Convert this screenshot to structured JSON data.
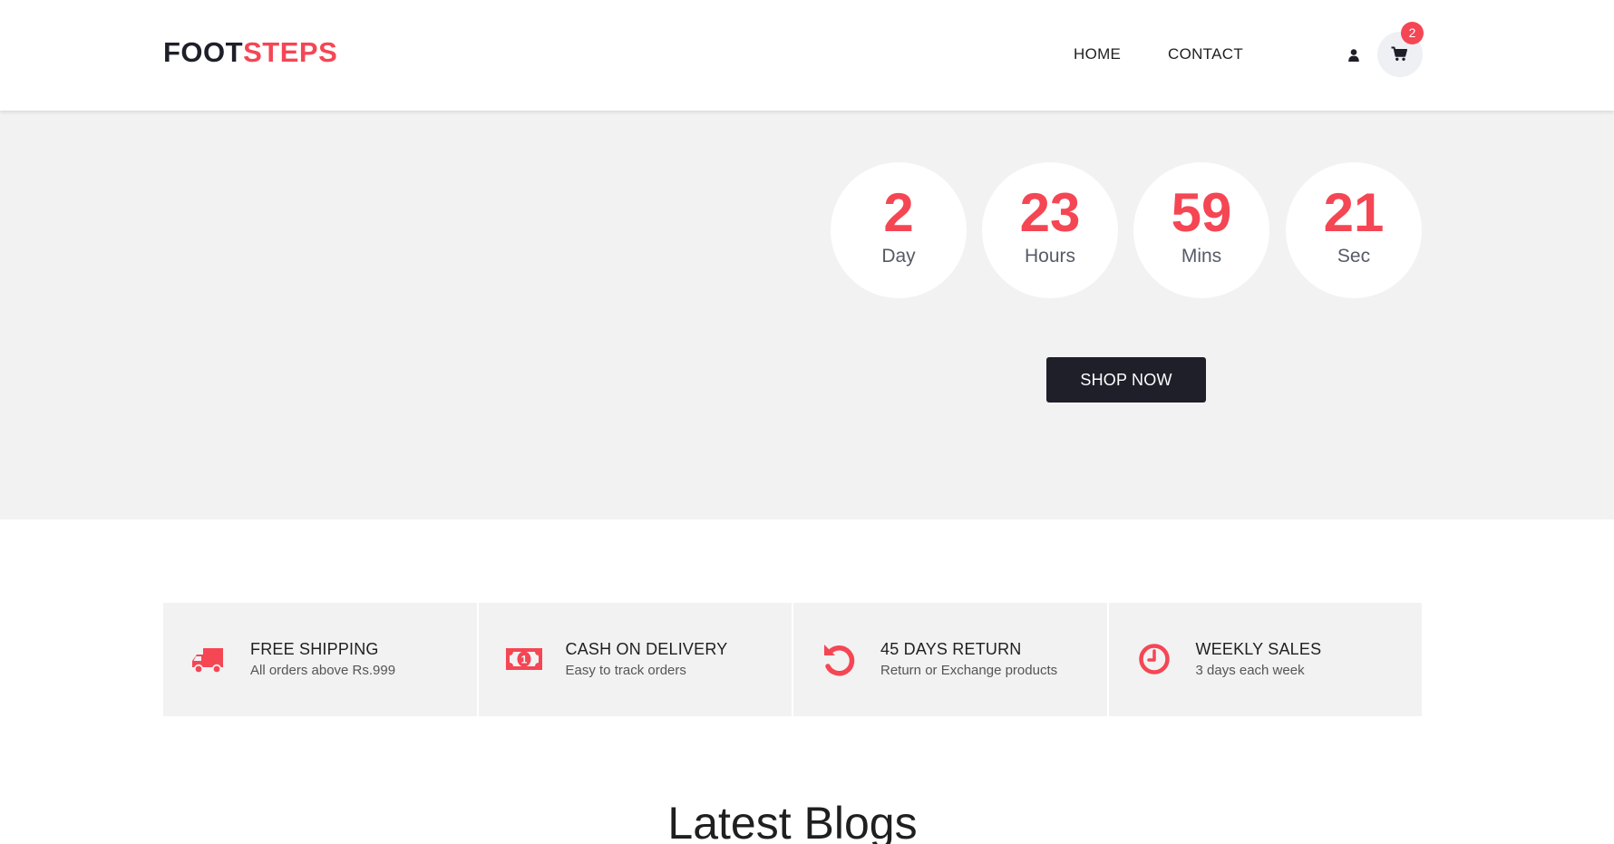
{
  "brand": {
    "part1": "FOOT",
    "part2": "STEPS",
    "accent_color": "#f54654",
    "dark_color": "#1f1f2a"
  },
  "nav": {
    "home": "HOME",
    "contact": "CONTACT"
  },
  "header_icons": {
    "user": "user-icon",
    "cart": "shopping-cart-icon"
  },
  "cart": {
    "count": "2"
  },
  "countdown": [
    {
      "value": "2",
      "label": "Day"
    },
    {
      "value": "23",
      "label": "Hours"
    },
    {
      "value": "59",
      "label": "Mins"
    },
    {
      "value": "21",
      "label": "Sec"
    }
  ],
  "hero": {
    "cta_label": "SHOP NOW"
  },
  "features": [
    {
      "icon": "truck-icon",
      "title": "FREE SHIPPING",
      "subtitle": "All orders above Rs.999"
    },
    {
      "icon": "money-icon",
      "title": "CASH ON DELIVERY",
      "subtitle": "Easy to track orders"
    },
    {
      "icon": "undo-icon",
      "title": "45 DAYS RETURN",
      "subtitle": "Return or Exchange products"
    },
    {
      "icon": "clock-icon",
      "title": "WEEKLY SALES",
      "subtitle": "3 days each week"
    }
  ],
  "blogs": {
    "heading": "Latest Blogs"
  }
}
